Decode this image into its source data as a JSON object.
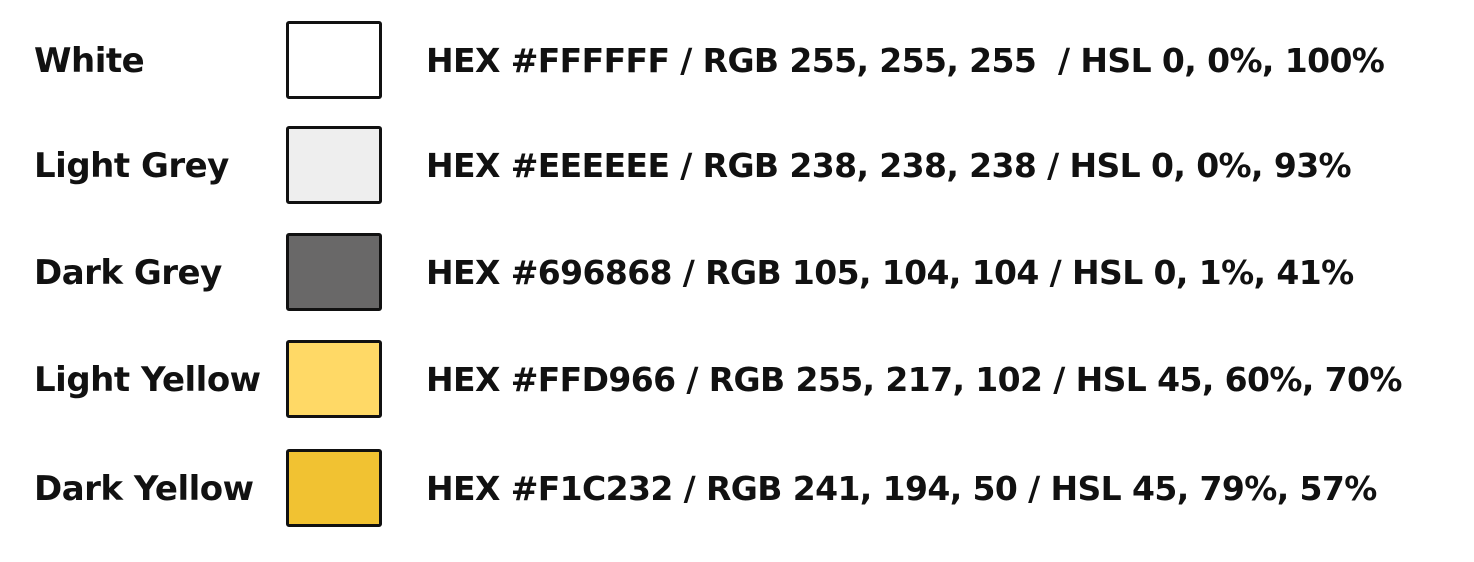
{
  "colors": [
    {
      "name": "White",
      "swatch_color": "#FFFFFF",
      "values": "HEX #FFFFFF / RGB 255, 255, 255  / HSL 0, 0%, 100%"
    },
    {
      "name": "Light Grey",
      "swatch_color": "#EEEEEE",
      "values": "HEX #EEEEEE / RGB 238, 238, 238 / HSL 0, 0%, 93%"
    },
    {
      "name": "Dark Grey",
      "swatch_color": "#696868",
      "values": "HEX #696868 / RGB 105, 104, 104 / HSL 0, 1%, 41%"
    },
    {
      "name": "Light Yellow",
      "swatch_color": "#FFD966",
      "values": "HEX #FFD966 / RGB 255, 217, 102 / HSL 45, 60%, 70%"
    },
    {
      "name": "Dark Yellow",
      "swatch_color": "#F1C232",
      "values": "HEX #F1C232 / RGB 241, 194, 50 / HSL 45, 79%, 57%"
    }
  ]
}
